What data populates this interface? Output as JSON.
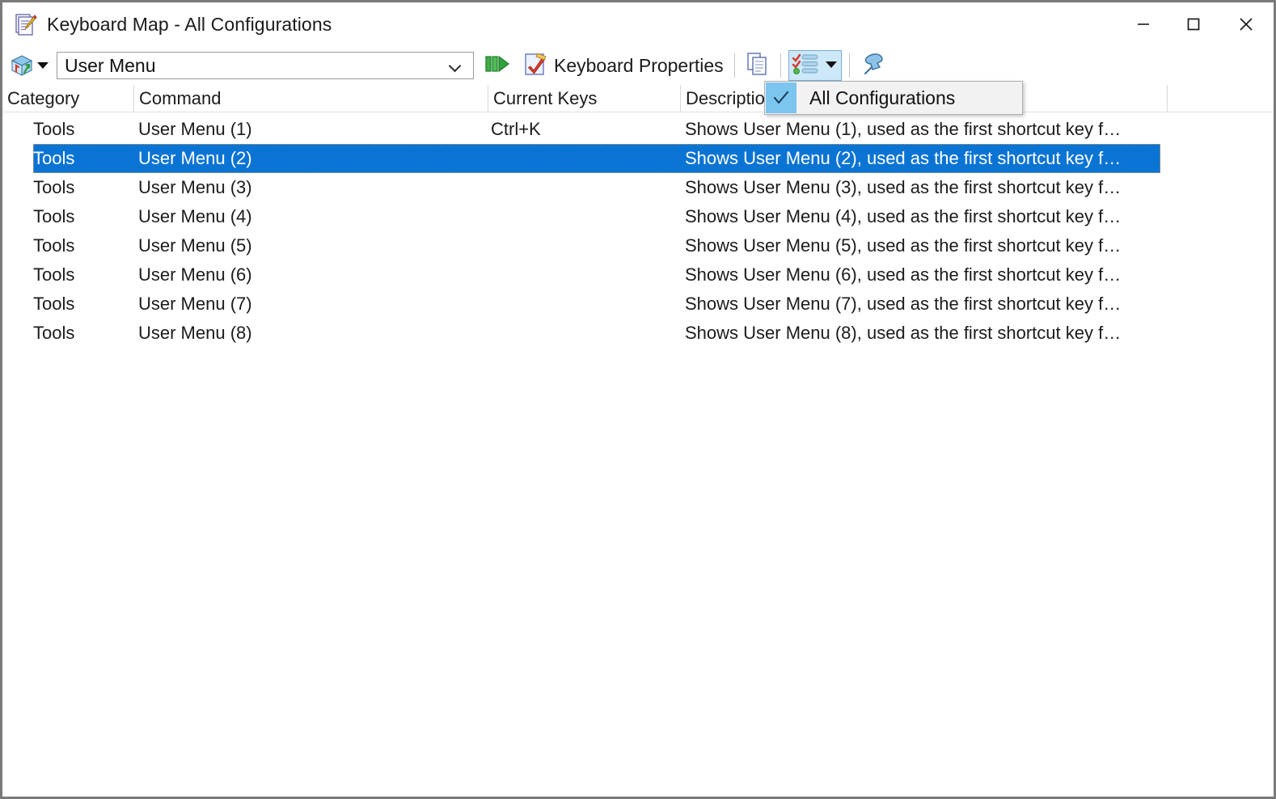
{
  "window": {
    "title": "Keyboard Map - All Configurations",
    "title_icon": "notepad-pencil-icon",
    "minimize_label": "—",
    "maximize_label": "□",
    "close_label": "✕"
  },
  "toolbar": {
    "config_icon": "keyboard-cube-icon",
    "config_caret_icon": "chevron-down-icon",
    "combo_value": "User Menu",
    "combo_arrow_icon": "chevron-down-icon",
    "run_icon": "green-play-icon",
    "keyboard_properties_icon": "clipboard-check-icon",
    "keyboard_properties_label": "Keyboard Properties",
    "copy_icon": "copy-documents-icon",
    "list_config_icon": "checklist-icon",
    "list_config_caret_icon": "caret-down-icon",
    "pin_icon": "pushpin-icon"
  },
  "menu": {
    "items": [
      {
        "label": "All Configurations",
        "checked": true,
        "check_icon": "checkmark-icon"
      }
    ]
  },
  "list": {
    "columns": [
      "Category",
      "Command",
      "Current Keys",
      "Description"
    ],
    "rows": [
      {
        "category": "Tools",
        "command": "User Menu (1)",
        "keys": "Ctrl+K",
        "description": "Shows User Menu (1), used as the first shortcut key f…",
        "selected": false
      },
      {
        "category": "Tools",
        "command": "User Menu (2)",
        "keys": "",
        "description": "Shows User Menu (2), used as the first shortcut key f…",
        "selected": true
      },
      {
        "category": "Tools",
        "command": "User Menu (3)",
        "keys": "",
        "description": "Shows User Menu (3), used as the first shortcut key f…",
        "selected": false
      },
      {
        "category": "Tools",
        "command": "User Menu (4)",
        "keys": "",
        "description": "Shows User Menu (4), used as the first shortcut key f…",
        "selected": false
      },
      {
        "category": "Tools",
        "command": "User Menu (5)",
        "keys": "",
        "description": "Shows User Menu (5), used as the first shortcut key f…",
        "selected": false
      },
      {
        "category": "Tools",
        "command": "User Menu (6)",
        "keys": "",
        "description": "Shows User Menu (6), used as the first shortcut key f…",
        "selected": false
      },
      {
        "category": "Tools",
        "command": "User Menu (7)",
        "keys": "",
        "description": "Shows User Menu (7), used as the first shortcut key f…",
        "selected": false
      },
      {
        "category": "Tools",
        "command": "User Menu (8)",
        "keys": "",
        "description": "Shows User Menu (8), used as the first shortcut key f…",
        "selected": false
      }
    ]
  },
  "colors": {
    "selection_blue": "#0a74d4",
    "menu_check_blue": "#7cc5ef",
    "toolbar_active_blue": "#cce8f9",
    "window_border": "#7a7a7a"
  }
}
